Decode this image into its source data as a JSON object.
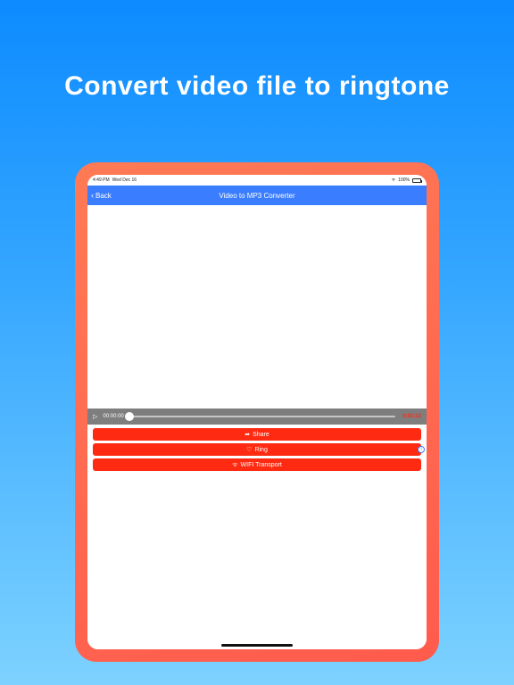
{
  "promo": {
    "headline": "Convert video file to ringtone"
  },
  "statusbar": {
    "time": "4:49 PM",
    "date": "Wed Dec 16",
    "battery_pct": "100%"
  },
  "navbar": {
    "back_label": "Back",
    "title": "Video to MP3 Converter"
  },
  "player": {
    "current_time": "00:00:00",
    "total_time": "0:01:13"
  },
  "actions": {
    "share_label": "Share",
    "ring_label": "Ring",
    "wifi_label": "WIFI Transport"
  }
}
